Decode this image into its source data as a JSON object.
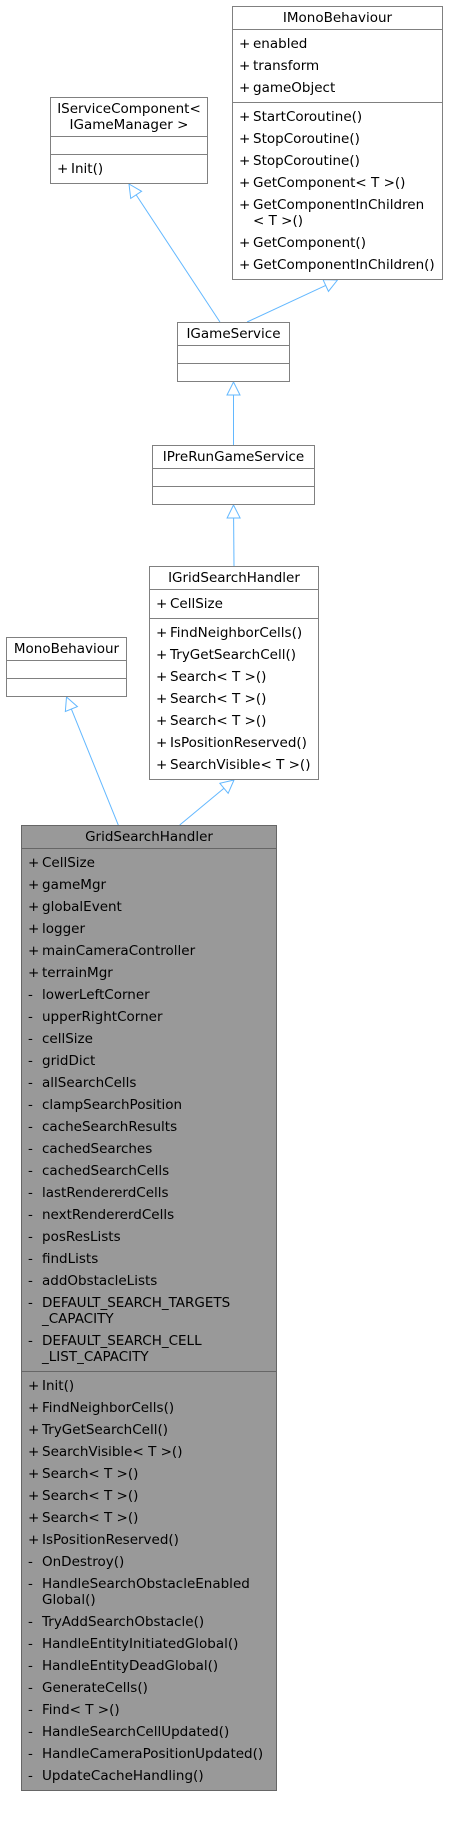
{
  "nodes": {
    "imonobehaviour": {
      "title": "IMonoBehaviour",
      "attributes": [
        {
          "vis": "+",
          "name": "enabled"
        },
        {
          "vis": "+",
          "name": "transform"
        },
        {
          "vis": "+",
          "name": "gameObject"
        }
      ],
      "operations": [
        {
          "vis": "+",
          "name": "StartCoroutine()"
        },
        {
          "vis": "+",
          "name": "StopCoroutine()"
        },
        {
          "vis": "+",
          "name": "StopCoroutine()"
        },
        {
          "vis": "+",
          "name": "GetComponent< T >()"
        },
        {
          "vis": "+",
          "name": "GetComponentInChildren\n< T >()"
        },
        {
          "vis": "+",
          "name": "GetComponent()"
        },
        {
          "vis": "+",
          "name": "GetComponentInChildren()"
        }
      ]
    },
    "iservicecomponent": {
      "title": "IServiceComponent<\nIGameManager >",
      "attributes": [],
      "operations": [
        {
          "vis": "+",
          "name": "Init()"
        }
      ]
    },
    "igameservice": {
      "title": "IGameService",
      "attributes": [],
      "operations": []
    },
    "iprerungameservice": {
      "title": "IPreRunGameService",
      "attributes": [],
      "operations": []
    },
    "igridsearchhandler": {
      "title": "IGridSearchHandler",
      "attributes": [
        {
          "vis": "+",
          "name": "CellSize"
        }
      ],
      "operations": [
        {
          "vis": "+",
          "name": "FindNeighborCells()"
        },
        {
          "vis": "+",
          "name": "TryGetSearchCell()"
        },
        {
          "vis": "+",
          "name": "Search< T >()"
        },
        {
          "vis": "+",
          "name": "Search< T >()"
        },
        {
          "vis": "+",
          "name": "Search< T >()"
        },
        {
          "vis": "+",
          "name": "IsPositionReserved()"
        },
        {
          "vis": "+",
          "name": "SearchVisible< T >()"
        }
      ]
    },
    "monobehaviour": {
      "title": "MonoBehaviour",
      "attributes": [],
      "operations": []
    },
    "gridsearchhandler": {
      "title": "GridSearchHandler",
      "attributes": [
        {
          "vis": "+",
          "name": "CellSize"
        },
        {
          "vis": "+",
          "name": "gameMgr"
        },
        {
          "vis": "+",
          "name": "globalEvent"
        },
        {
          "vis": "+",
          "name": "logger"
        },
        {
          "vis": "+",
          "name": "mainCameraController"
        },
        {
          "vis": "+",
          "name": "terrainMgr"
        },
        {
          "vis": "-",
          "name": "lowerLeftCorner"
        },
        {
          "vis": "-",
          "name": "upperRightCorner"
        },
        {
          "vis": "-",
          "name": "cellSize"
        },
        {
          "vis": "-",
          "name": "gridDict"
        },
        {
          "vis": "-",
          "name": "allSearchCells"
        },
        {
          "vis": "-",
          "name": "clampSearchPosition"
        },
        {
          "vis": "-",
          "name": "cacheSearchResults"
        },
        {
          "vis": "-",
          "name": "cachedSearches"
        },
        {
          "vis": "-",
          "name": "cachedSearchCells"
        },
        {
          "vis": "-",
          "name": "lastRendererdCells"
        },
        {
          "vis": "-",
          "name": "nextRendererdCells"
        },
        {
          "vis": "-",
          "name": "posResLists"
        },
        {
          "vis": "-",
          "name": "findLists"
        },
        {
          "vis": "-",
          "name": "addObstacleLists"
        },
        {
          "vis": "-",
          "name": "DEFAULT_SEARCH_TARGETS\n_CAPACITY"
        },
        {
          "vis": "-",
          "name": "DEFAULT_SEARCH_CELL\n_LIST_CAPACITY"
        }
      ],
      "operations": [
        {
          "vis": "+",
          "name": "Init()"
        },
        {
          "vis": "+",
          "name": "FindNeighborCells()"
        },
        {
          "vis": "+",
          "name": "TryGetSearchCell()"
        },
        {
          "vis": "+",
          "name": "SearchVisible< T >()"
        },
        {
          "vis": "+",
          "name": "Search< T >()"
        },
        {
          "vis": "+",
          "name": "Search< T >()"
        },
        {
          "vis": "+",
          "name": "Search< T >()"
        },
        {
          "vis": "+",
          "name": "IsPositionReserved()"
        },
        {
          "vis": "-",
          "name": "OnDestroy()"
        },
        {
          "vis": "-",
          "name": "HandleSearchObstacleEnabled\nGlobal()"
        },
        {
          "vis": "-",
          "name": "TryAddSearchObstacle()"
        },
        {
          "vis": "-",
          "name": "HandleEntityInitiatedGlobal()"
        },
        {
          "vis": "-",
          "name": "HandleEntityDeadGlobal()"
        },
        {
          "vis": "-",
          "name": "GenerateCells()"
        },
        {
          "vis": "-",
          "name": "Find< T >()"
        },
        {
          "vis": "-",
          "name": "HandleSearchCellUpdated()"
        },
        {
          "vis": "-",
          "name": "HandleCameraPositionUpdated()"
        },
        {
          "vis": "-",
          "name": "UpdateCacheHandling()"
        }
      ]
    }
  },
  "edges": [
    {
      "from": "igameservice",
      "to": "iservicecomponent",
      "type": "inheritance"
    },
    {
      "from": "igameservice",
      "to": "imonobehaviour",
      "type": "inheritance"
    },
    {
      "from": "iprerungameservice",
      "to": "igameservice",
      "type": "inheritance"
    },
    {
      "from": "igridsearchhandler",
      "to": "iprerungameservice",
      "type": "inheritance"
    },
    {
      "from": "gridsearchhandler",
      "to": "monobehaviour",
      "type": "inheritance"
    },
    {
      "from": "gridsearchhandler",
      "to": "igridsearchhandler",
      "type": "inheritance"
    }
  ],
  "colors": {
    "edge": "#63b8ff",
    "border": "#808080",
    "main_fill": "#999999"
  }
}
